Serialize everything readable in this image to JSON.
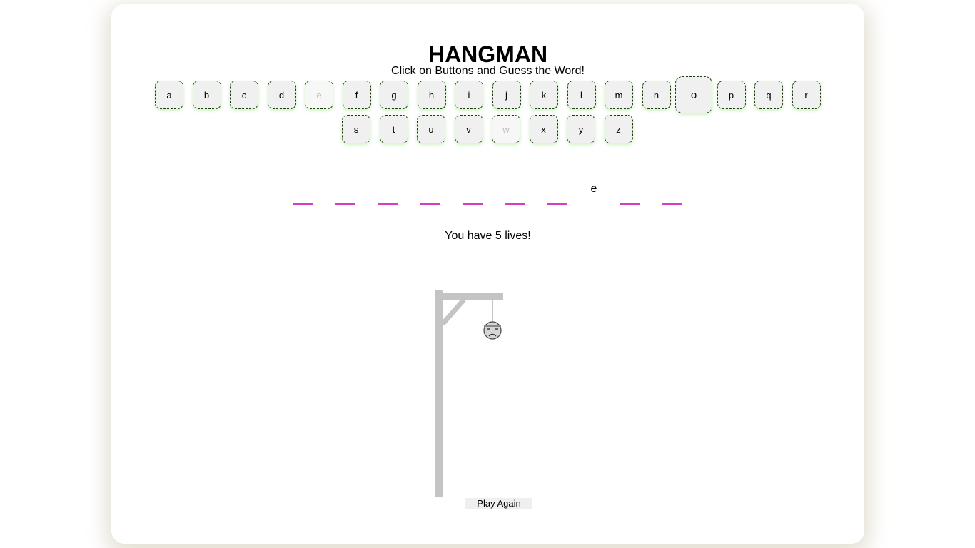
{
  "title": "HANGMAN",
  "subtitle": "Click on Buttons and Guess the Word!",
  "keyboard": {
    "row1": [
      "a",
      "b",
      "c",
      "d",
      "e",
      "f",
      "g",
      "h",
      "i",
      "j",
      "k",
      "l",
      "m",
      "n",
      "o",
      "p",
      "q",
      "r"
    ],
    "row2": [
      "s",
      "t",
      "u",
      "v",
      "w",
      "x",
      "y",
      "z"
    ],
    "used_letters": [
      "e",
      "w"
    ],
    "hovered_letter": "o"
  },
  "word": {
    "slots": [
      "",
      "",
      "",
      "",
      "",
      "",
      "",
      "e",
      "",
      ""
    ]
  },
  "lives_text": "You have 5 lives!",
  "play_again_label": "Play Again",
  "colors": {
    "dash": "#d63cc4",
    "gallows": "#c4c4c4",
    "key_border": "#1f3a10",
    "key_glow": "#8ce66e"
  },
  "icons": {
    "hangman_head": "sad-face-head-icon"
  }
}
